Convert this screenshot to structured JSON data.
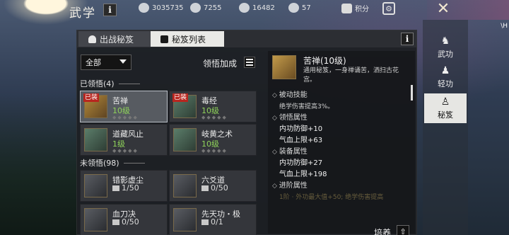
{
  "header": {
    "title": "武学",
    "info_label": "i",
    "resources": [
      {
        "icon": "coin-stack-icon",
        "value": "3035735"
      },
      {
        "icon": "gem-icon",
        "value": "7255"
      },
      {
        "icon": "leaf-icon",
        "value": "16482"
      },
      {
        "icon": "pouch-icon",
        "value": "57"
      }
    ],
    "points_label": "积分",
    "corner_text": "\\H"
  },
  "tabs": [
    {
      "label": "出战秘笈",
      "active": false
    },
    {
      "label": "秘笈列表",
      "active": true
    }
  ],
  "panel_info": "i",
  "filter": {
    "selected": "全部"
  },
  "bonus_label": "领悟加成",
  "sections": {
    "learned": "已领悟(4)",
    "unlearned": "未领悟(98)"
  },
  "learned_cards": [
    {
      "name": "苦禅",
      "level": "10级",
      "badge": "已装",
      "selected": true,
      "stars": "◆◆◆◆◆"
    },
    {
      "name": "毒经",
      "level": "10级",
      "badge": "已装",
      "selected": false,
      "stars": "◆◆◆◆◆"
    },
    {
      "name": "道藏风止",
      "level": "1级",
      "badge": "",
      "selected": false,
      "stars": "◆◆◆◆◆"
    },
    {
      "name": "岐黄之术",
      "level": "10级",
      "badge": "",
      "selected": false,
      "stars": "◆◆◆◆◆"
    }
  ],
  "unlearned_cards": [
    {
      "name": "错影虚尘",
      "progress": "1/50"
    },
    {
      "name": "六爻道",
      "progress": "0/50"
    },
    {
      "name": "血刀决",
      "progress": "0/50"
    },
    {
      "name": "先天功・极",
      "progress": "0/1"
    }
  ],
  "detail": {
    "title": "苦禅(10级)",
    "desc": "通用秘笈，一身禅诵苦，洒扫古花宫。",
    "lines": [
      {
        "kind": "h",
        "text": "被动技能"
      },
      {
        "kind": "sub",
        "text": "绝学伤害提高3%。"
      },
      {
        "kind": "h",
        "text": "领悟属性"
      },
      {
        "kind": "stat",
        "text": "内功防御+10"
      },
      {
        "kind": "stat",
        "text": "气血上限+63"
      },
      {
        "kind": "h",
        "text": "装备属性"
      },
      {
        "kind": "stat",
        "text": "内功防御+27"
      },
      {
        "kind": "stat",
        "text": "气血上限+198"
      },
      {
        "kind": "h",
        "text": "进阶属性"
      },
      {
        "kind": "faded",
        "text": "1阶 · 外功最大值+50; 绝学伤害提高"
      }
    ],
    "train_label": "培养"
  },
  "right_nav": [
    {
      "label": "武功",
      "icon": "martial-figure-icon",
      "active": false
    },
    {
      "label": "轻功",
      "icon": "running-figure-icon",
      "active": false
    },
    {
      "label": "秘笈",
      "icon": "meditating-figure-icon",
      "active": true
    }
  ]
}
